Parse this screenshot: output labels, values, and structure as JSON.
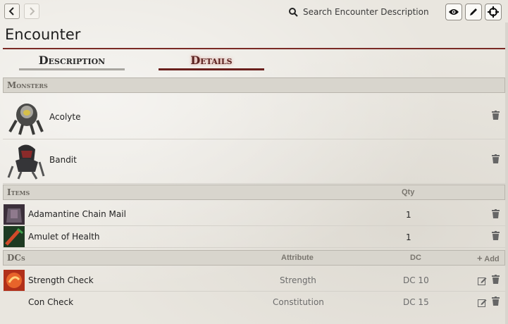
{
  "header": {
    "search_placeholder": "Search Encounter Description",
    "page_title": "Encounter"
  },
  "tabs": [
    {
      "label": "Description",
      "active": false
    },
    {
      "label": "Details",
      "active": true
    }
  ],
  "monsters": {
    "title": "Monsters",
    "items": [
      {
        "name": "Acolyte"
      },
      {
        "name": "Bandit"
      }
    ]
  },
  "items": {
    "title": "Items",
    "qty_header": "Qty",
    "rows": [
      {
        "name": "Adamantine Chain Mail",
        "qty": "1"
      },
      {
        "name": "Amulet of Health",
        "qty": "1"
      }
    ]
  },
  "dcs": {
    "title": "DCs",
    "attribute_header": "Attribute",
    "dc_header": "DC",
    "add_label": "Add",
    "rows": [
      {
        "name": "Strength Check",
        "attribute": "Strength",
        "dc": "DC 10"
      },
      {
        "name": "Con Check",
        "attribute": "Constitution",
        "dc": "DC 15"
      }
    ]
  },
  "colors": {
    "accent": "#7a2a25",
    "active_tab": "#5a2220"
  }
}
